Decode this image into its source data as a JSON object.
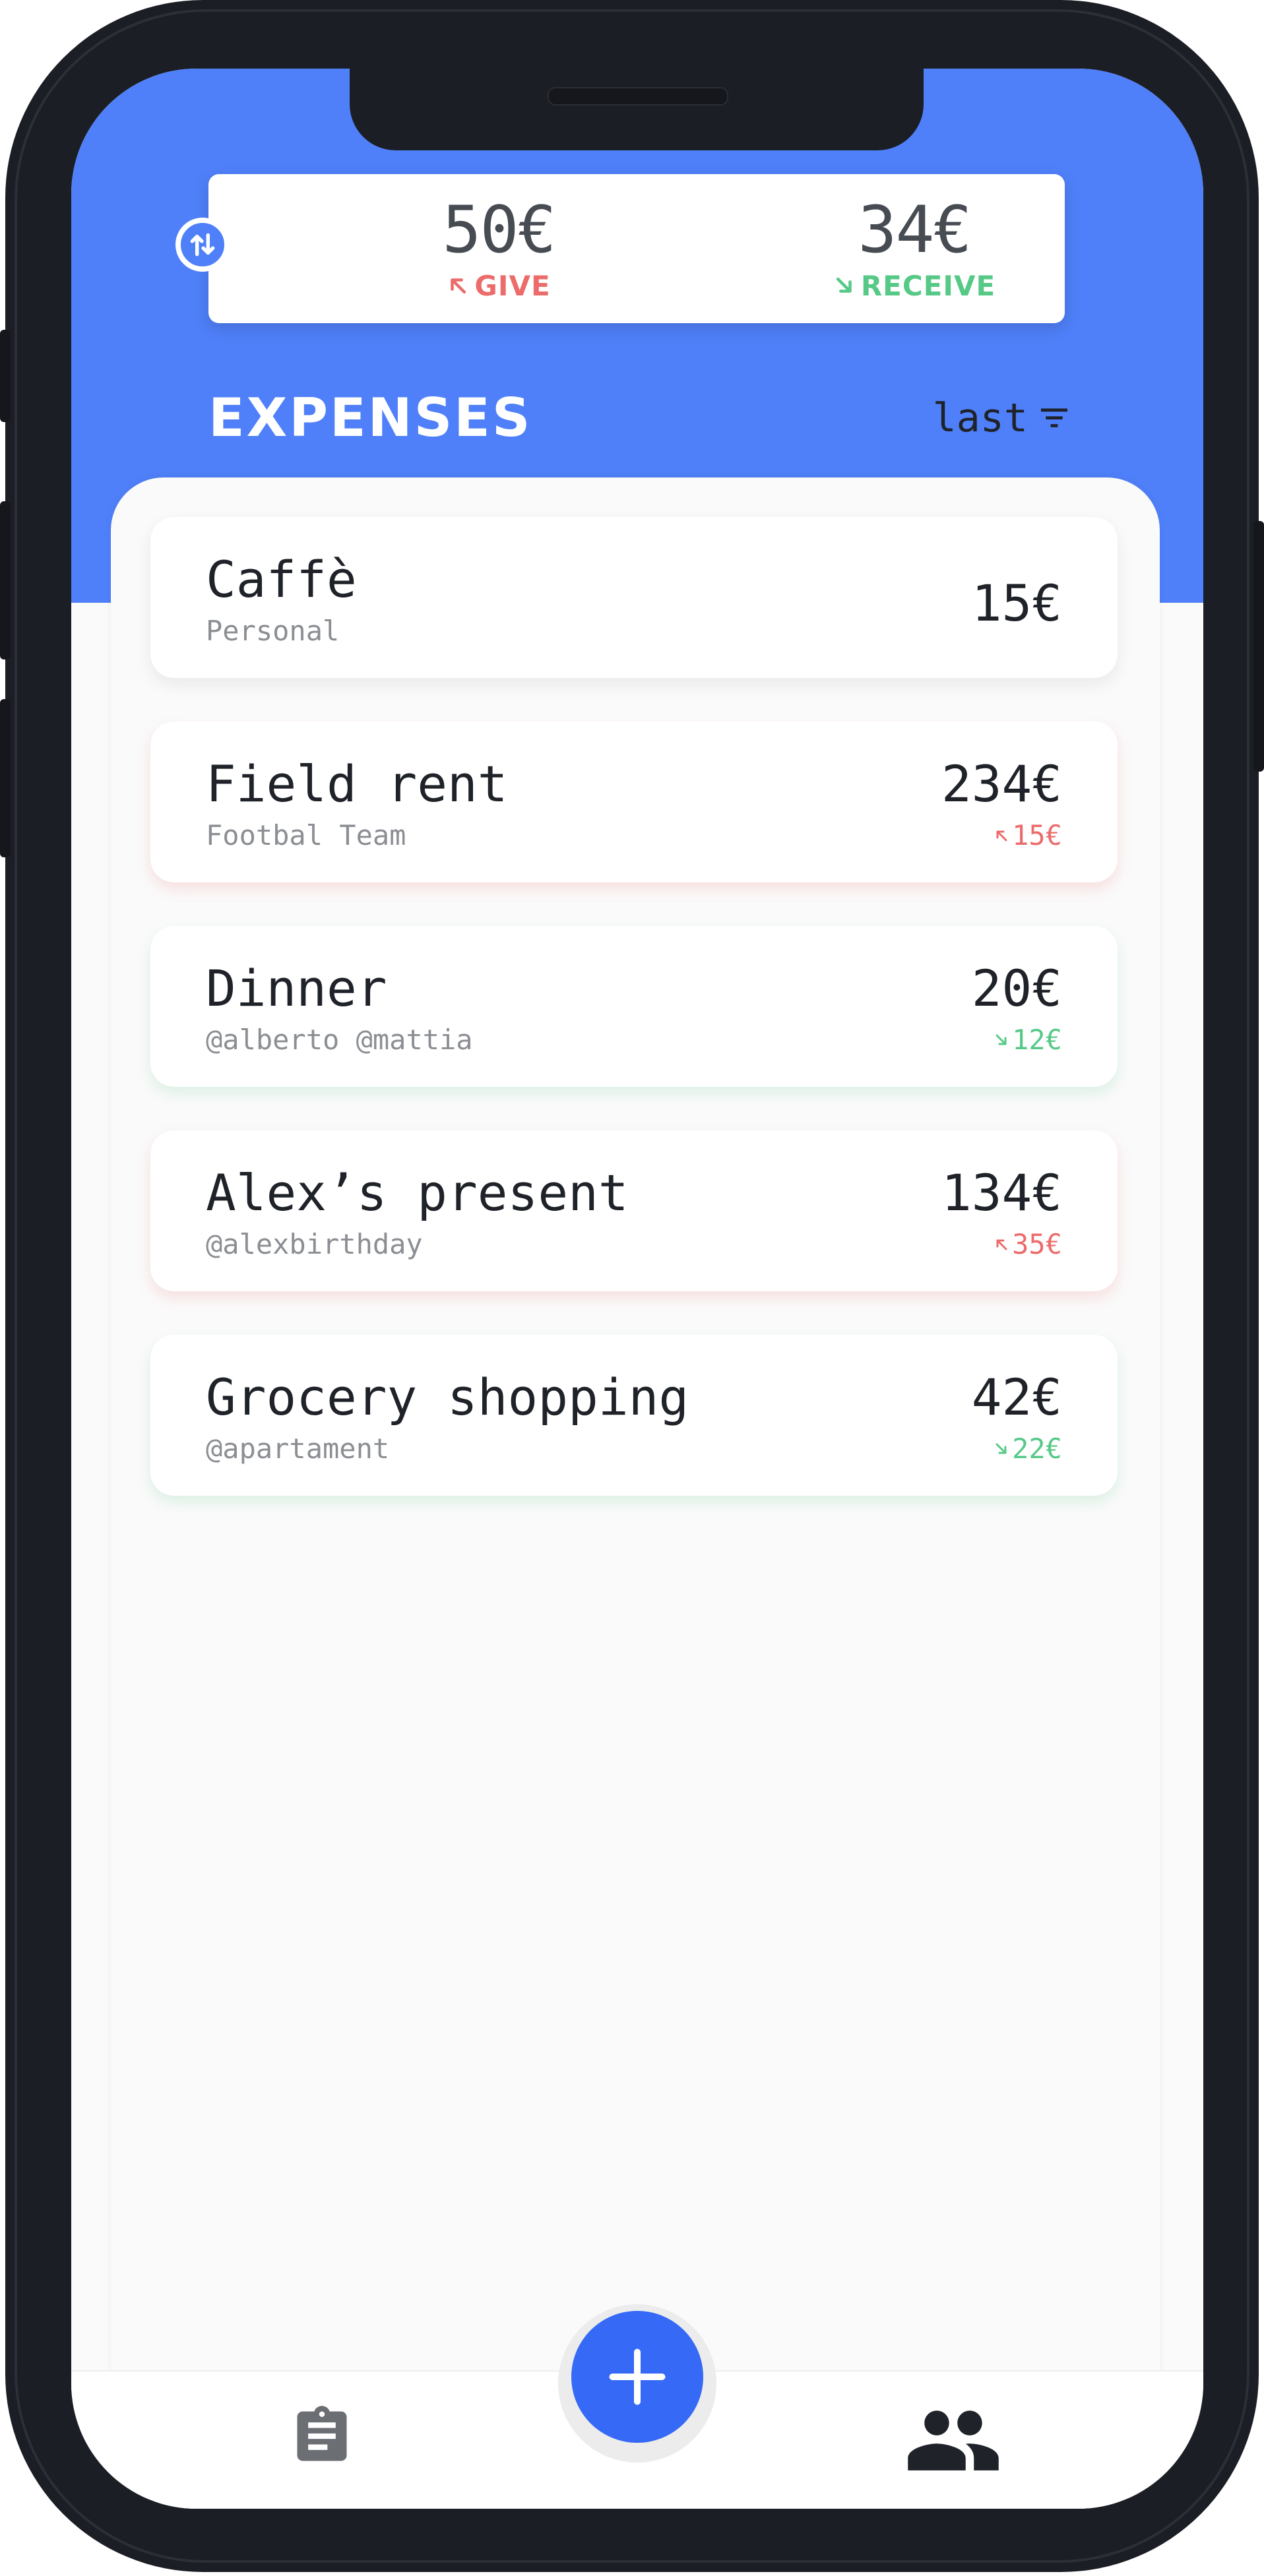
{
  "balance": {
    "give_amount": "50€",
    "give_label": "GIVE",
    "receive_amount": "34€",
    "receive_label": "RECEIVE"
  },
  "header": {
    "title": "EXPENSES",
    "sort_label": "last"
  },
  "expenses": [
    {
      "title": "Caffè",
      "subtitle": "Personal",
      "amount": "15€",
      "share": "",
      "share_type": "none"
    },
    {
      "title": "Field rent",
      "subtitle": "Footbal Team",
      "amount": "234€",
      "share": "15€",
      "share_type": "give"
    },
    {
      "title": "Dinner",
      "subtitle": "@alberto @mattia",
      "amount": "20€",
      "share": "12€",
      "share_type": "receive"
    },
    {
      "title": "Alex’s present",
      "subtitle": "@alexbirthday",
      "amount": "134€",
      "share": "35€",
      "share_type": "give"
    },
    {
      "title": "Grocery shopping",
      "subtitle": "@apartament",
      "amount": "42€",
      "share": "22€",
      "share_type": "receive"
    }
  ],
  "icons": {
    "swap": "swap-vertical-icon",
    "sort": "filter-sort-icon",
    "add": "plus-icon",
    "nav_left": "clipboard-icon",
    "nav_right": "group-people-icon"
  },
  "colors": {
    "primary": "#4f80f9",
    "fab": "#3569f6",
    "give": "#ec6b6b",
    "receive": "#56c987"
  }
}
